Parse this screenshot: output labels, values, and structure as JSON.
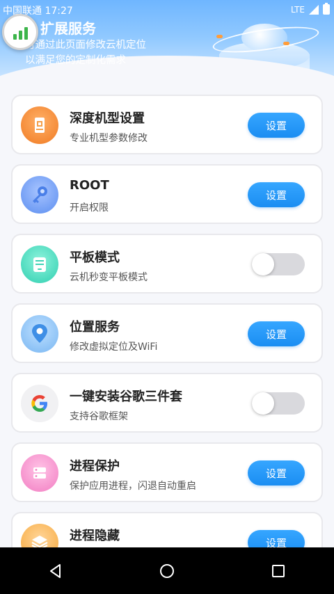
{
  "status": {
    "carrier": "中国联通",
    "time": "17:27",
    "network": "LTE"
  },
  "header": {
    "title": "扩展服务",
    "desc_line1": "可通过此页面修改云机定位",
    "desc_line2": "以满足您的定制化需求"
  },
  "items": [
    {
      "title": "深度机型设置",
      "subtitle": "专业机型参数修改",
      "control": "button",
      "button_label": "设置",
      "icon": "phone-model-icon"
    },
    {
      "title": "ROOT",
      "subtitle": "开启权限",
      "control": "button",
      "button_label": "设置",
      "icon": "key-icon"
    },
    {
      "title": "平板模式",
      "subtitle": "云机秒变平板模式",
      "control": "toggle",
      "toggle_on": false,
      "icon": "tablet-icon"
    },
    {
      "title": "位置服务",
      "subtitle": "修改虚拟定位及WiFi",
      "control": "button",
      "button_label": "设置",
      "icon": "location-pin-icon"
    },
    {
      "title": "一键安装谷歌三件套",
      "subtitle": "支持谷歌框架",
      "control": "toggle",
      "toggle_on": false,
      "icon": "google-icon"
    },
    {
      "title": "进程保护",
      "subtitle": "保护应用进程，闪退自动重启",
      "control": "button",
      "button_label": "设置",
      "icon": "process-protect-icon"
    },
    {
      "title": "进程隐藏",
      "subtitle": "",
      "control": "button",
      "button_label": "设置",
      "icon": "layers-icon"
    }
  ],
  "colors": {
    "accent": "#1a8df2",
    "toggle_off": "#d9d9dd",
    "header": "#6fb6ff"
  },
  "nav": [
    "back-icon",
    "home-icon",
    "recents-icon"
  ]
}
